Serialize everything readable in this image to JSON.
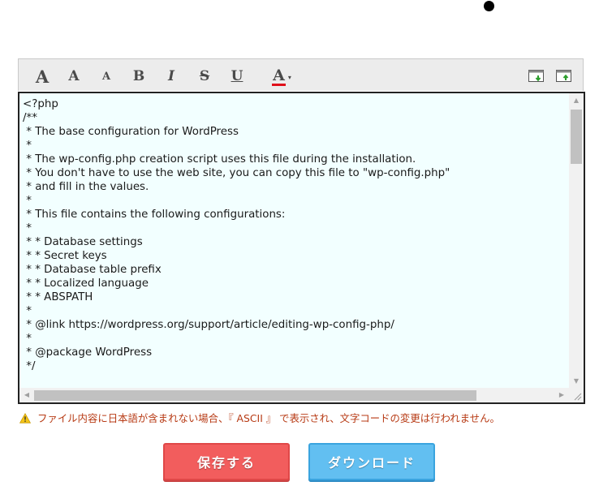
{
  "toolbar": {
    "font_large": "A",
    "font_medium": "A",
    "font_small": "A",
    "bold": "B",
    "italic": "I",
    "strike": "S",
    "underline": "U",
    "font_color": "A",
    "font_color_swatch": "#e0101a",
    "caret": "▾"
  },
  "editor": {
    "content": "<?php\n/**\n * The base configuration for WordPress\n *\n * The wp-config.php creation script uses this file during the installation.\n * You don't have to use the web site, you can copy this file to \"wp-config.php\"\n * and fill in the values.\n *\n * This file contains the following configurations:\n *\n * * Database settings\n * * Secret keys\n * * Database table prefix\n * * Localized language\n * * ABSPATH\n *\n * @link https://wordpress.org/support/article/editing-wp-config-php/\n *\n * @package WordPress\n */"
  },
  "warning": {
    "text": "ファイル内容に日本語が含まれない場合、『 ASCII 』 で表示され、文字コードの変更は行われません。"
  },
  "buttons": {
    "save": "保存する",
    "download": "ダウンロード"
  },
  "colors": {
    "save_bg": "#f25d5d",
    "download_bg": "#62bff1",
    "editor_bg": "#f2ffff",
    "warning_text": "#b73a14"
  }
}
